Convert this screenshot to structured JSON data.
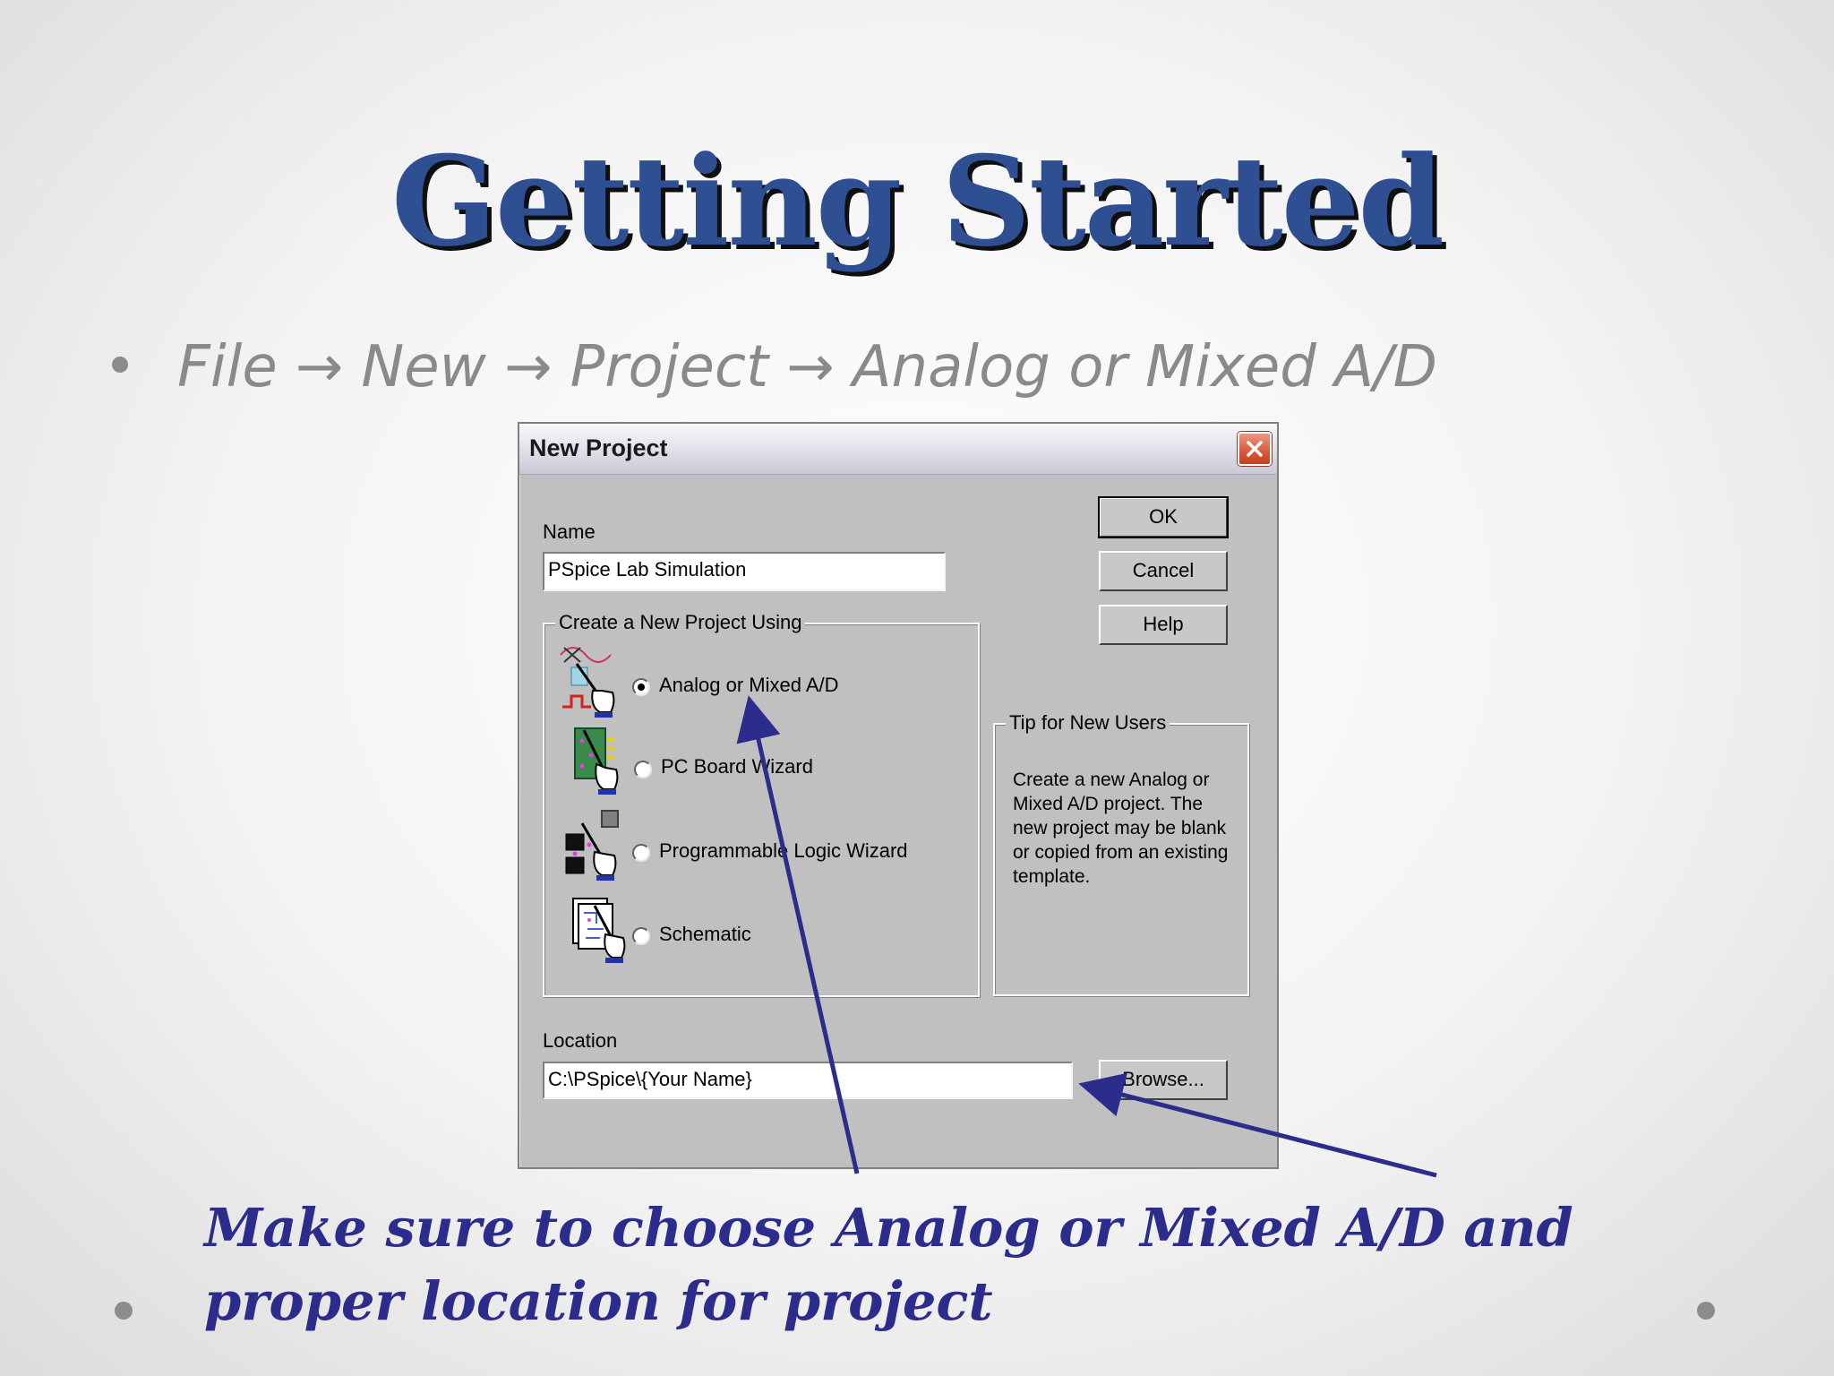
{
  "slide": {
    "title": "Getting Started",
    "bullet": {
      "step1": "File",
      "step2": "New",
      "step3": "Project",
      "step4": "Analog or Mixed A/D",
      "arrow": "→"
    },
    "annotation": "Make sure to choose Analog or Mixed A/D and proper location for project"
  },
  "dialog": {
    "title": "New Project",
    "name_label": "Name",
    "name_value": "PSpice Lab Simulation",
    "group_label": "Create a New Project Using",
    "options": [
      {
        "label": "Analog or Mixed A/D",
        "checked": true,
        "icon": "analog-project-icon"
      },
      {
        "label": "PC Board Wizard",
        "checked": false,
        "icon": "pcb-wizard-icon"
      },
      {
        "label": "Programmable Logic Wizard",
        "checked": false,
        "icon": "logic-wizard-icon"
      },
      {
        "label": "Schematic",
        "checked": false,
        "icon": "schematic-icon"
      }
    ],
    "ok_label": "OK",
    "cancel_label": "Cancel",
    "help_label": "Help",
    "tip_label": "Tip for New Users",
    "tip_text": "Create a new Analog or\nMixed A/D project.  The\nnew project may be blank\nor copied from an existing\ntemplate.",
    "location_label": "Location",
    "location_value": "C:\\PSpice\\{Your Name}",
    "browse_label": "Browse..."
  },
  "colors": {
    "title": "#2f4f93",
    "annotation": "#2c2c8c",
    "bullet_text": "#8a8a8a",
    "dialog_face": "#c0c0c0",
    "close_button": "#d9573b"
  }
}
